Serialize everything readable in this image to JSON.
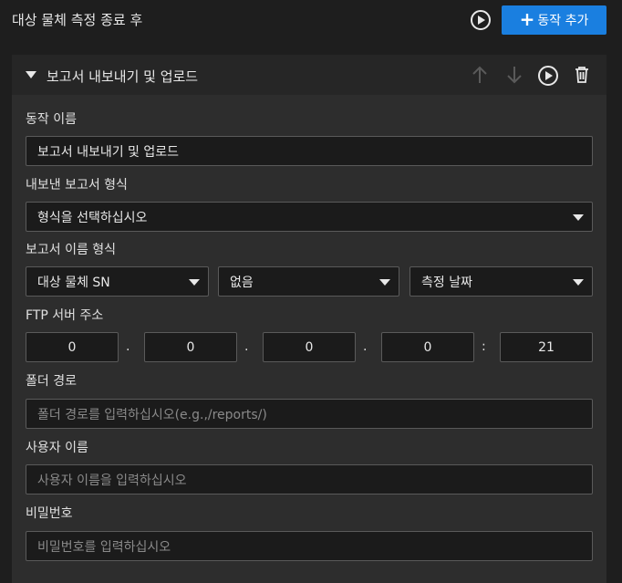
{
  "top": {
    "title": "대상 물체 측정 종료 후",
    "add_button": "동작 추가"
  },
  "action": {
    "title": "보고서 내보내기 및 업로드"
  },
  "form": {
    "name_label": "동작 이름",
    "name_value": "보고서 내보내기 및 업로드",
    "format_label": "내보낸 보고서 형식",
    "format_value": "형식을 선택하십시오",
    "filename_label": "보고서 이름 형식",
    "filename_parts": [
      "대상 물체 SN",
      "없음",
      "측정 날짜"
    ],
    "ftp_label": "FTP 서버 주소",
    "ftp_octets": [
      "0",
      "0",
      "0",
      "0"
    ],
    "ftp_dot": ".",
    "ftp_colon": ":",
    "ftp_port": "21",
    "folder_label": "폴더 경로",
    "folder_placeholder": "폴더 경로를 입력하십시오(e.g.,/reports/)",
    "user_label": "사용자 이름",
    "user_placeholder": "사용자 이름을 입력하십시오",
    "password_label": "비밀번호",
    "password_placeholder": "비밀번호를 입력하십시오"
  },
  "colors": {
    "accent": "#1a7fe0",
    "background": "#1e1e1e",
    "panel": "#2d2d2d",
    "disabled_icon": "#5a5a5a"
  }
}
